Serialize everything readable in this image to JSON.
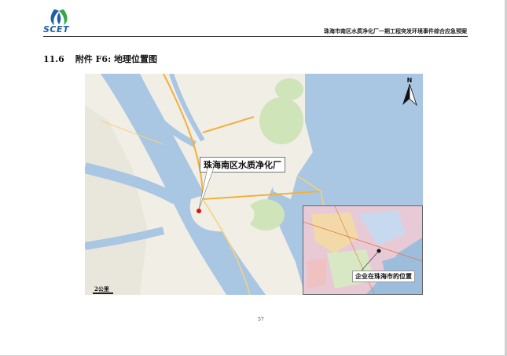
{
  "header": {
    "logo_text": "SCET",
    "title": "珠海市南区水质净化厂一期工程突发环境事件综合应急预案"
  },
  "section": {
    "number": "11.6",
    "title": "附件 F6: 地理位置图"
  },
  "map": {
    "callout_label": "珠海南区水质净化厂",
    "scale_label": "2公里",
    "north_label": "N",
    "inset_label": "企业在珠海市的位置",
    "marker_color": "#e11111",
    "water_color": "#a9c6e3",
    "land_color": "#f1eee6"
  },
  "page_number": "57"
}
